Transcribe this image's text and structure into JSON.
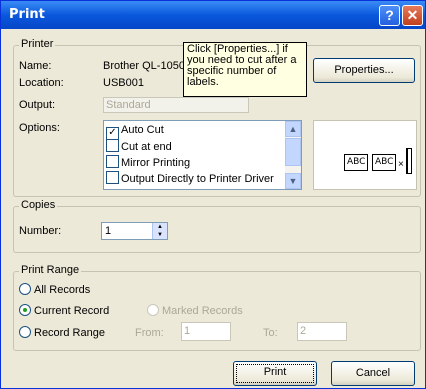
{
  "window": {
    "title": "Print"
  },
  "printer": {
    "legend": "Printer",
    "name_label": "Name:",
    "name_value": "Brother QL-1050",
    "location_label": "Location:",
    "location_value": "USB001",
    "output_label": "Output:",
    "output_value": "Standard",
    "options_label": "Options:",
    "properties_button": "Properties...",
    "tooltip": "Click [Properties...] if you need to cut after a specific number of labels.",
    "options": [
      {
        "label": "Auto Cut",
        "checked": true
      },
      {
        "label": "Cut at end",
        "checked": false
      },
      {
        "label": "Mirror Printing",
        "checked": false
      },
      {
        "label": "Output Directly to Printer Driver",
        "checked": false
      }
    ],
    "preview_labels": [
      "ABC",
      "ABC"
    ]
  },
  "copies": {
    "legend": "Copies",
    "number_label": "Number:",
    "number_value": "1"
  },
  "print_range": {
    "legend": "Print Range",
    "all_records": "All Records",
    "current_record": "Current Record",
    "marked_records": "Marked Records",
    "record_range": "Record Range",
    "from_label": "From:",
    "from_value": "1",
    "to_label": "To:",
    "to_value": "2"
  },
  "footer": {
    "print_button": "Print",
    "cancel_button": "Cancel"
  }
}
